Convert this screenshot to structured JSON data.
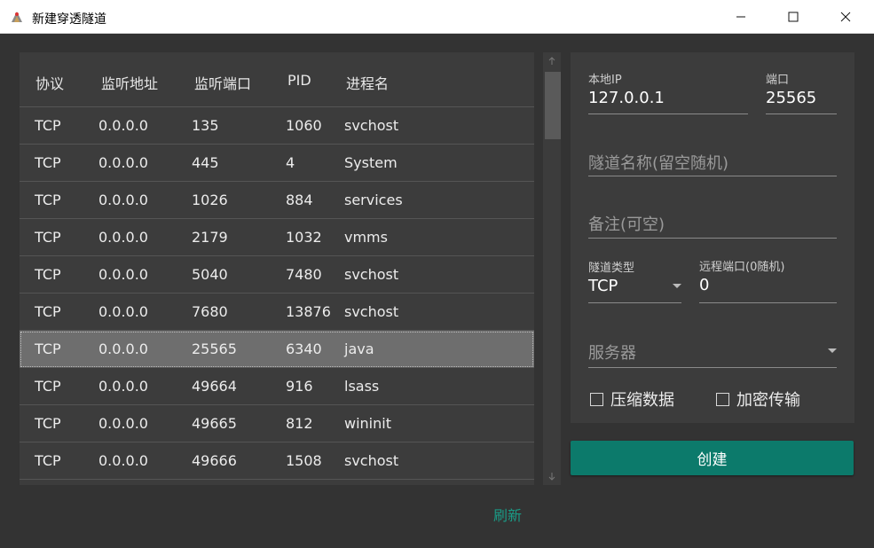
{
  "window": {
    "title": "新建穿透隧道",
    "minimize_icon": "minimize-icon",
    "maximize_icon": "maximize-icon",
    "close_icon": "close-icon"
  },
  "table": {
    "columns": [
      "协议",
      "监听地址",
      "监听端口",
      "PID",
      "进程名"
    ],
    "selected_index": 6,
    "rows": [
      [
        "TCP",
        "0.0.0.0",
        "135",
        "1060",
        "svchost"
      ],
      [
        "TCP",
        "0.0.0.0",
        "445",
        "4",
        "System"
      ],
      [
        "TCP",
        "0.0.0.0",
        "1026",
        "884",
        "services"
      ],
      [
        "TCP",
        "0.0.0.0",
        "2179",
        "1032",
        "vmms"
      ],
      [
        "TCP",
        "0.0.0.0",
        "5040",
        "7480",
        "svchost"
      ],
      [
        "TCP",
        "0.0.0.0",
        "7680",
        "13876",
        "svchost"
      ],
      [
        "TCP",
        "0.0.0.0",
        "25565",
        "6340",
        "java"
      ],
      [
        "TCP",
        "0.0.0.0",
        "49664",
        "916",
        "lsass"
      ],
      [
        "TCP",
        "0.0.0.0",
        "49665",
        "812",
        "wininit"
      ],
      [
        "TCP",
        "0.0.0.0",
        "49666",
        "1508",
        "svchost"
      ]
    ]
  },
  "refresh_label": "刷新",
  "form": {
    "local_ip_label": "本地IP",
    "local_ip_value": "127.0.0.1",
    "port_label": "端口",
    "port_value": "25565",
    "tunnel_name_placeholder": "隧道名称(留空随机)",
    "remark_placeholder": "备注(可空)",
    "tunnel_type_label": "隧道类型",
    "tunnel_type_value": "TCP",
    "remote_port_label": "远程端口(0随机)",
    "remote_port_value": "0",
    "server_placeholder": "服务器",
    "compress_label": "压缩数据",
    "encrypt_label": "加密传输"
  },
  "create_label": "创建",
  "colors": {
    "accent": "#0c7a6b",
    "link": "#1a9b86",
    "background": "#333333",
    "panel": "#3c3c3c",
    "selected_row": "#6e6e6e"
  }
}
